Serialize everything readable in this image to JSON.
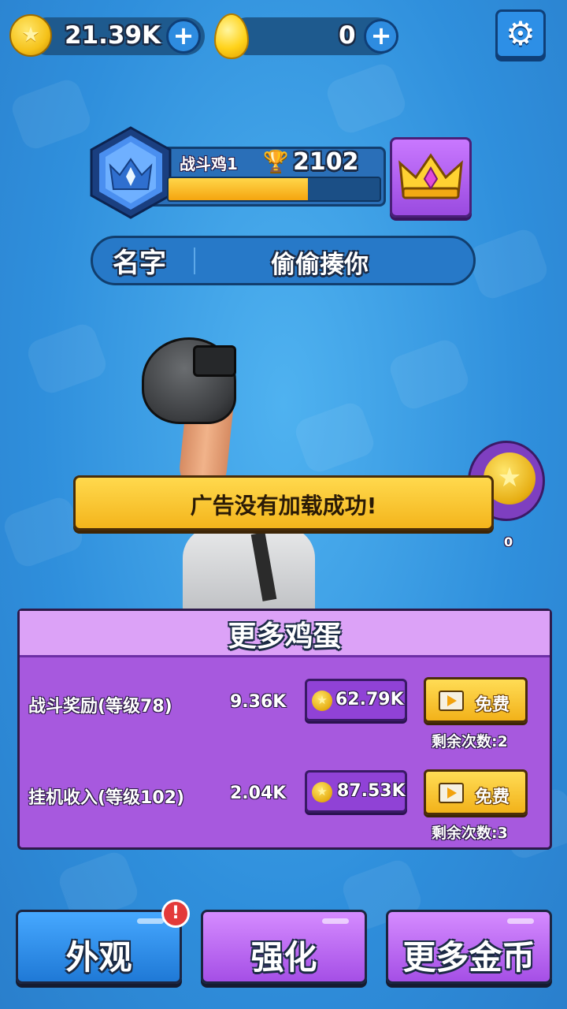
{
  "currency": {
    "coins": "21.39K",
    "eggs": "0"
  },
  "player": {
    "name": "战斗鸡1",
    "trophies": "2102",
    "xp_progress": 0.66
  },
  "profile": {
    "name_label": "名字",
    "name_value": "偷偷揍你"
  },
  "toast": {
    "message": "广告没有加载成功!"
  },
  "side_reward": {
    "count": "0"
  },
  "more_eggs": {
    "title": "更多鸡蛋",
    "rows": [
      {
        "label": "战斗奖励(等级78)",
        "rate": "9.36K",
        "cost": "62.79K",
        "free_label": "免费",
        "remaining": "剩余次数:2"
      },
      {
        "label": "挂机收入(等级102)",
        "rate": "2.04K",
        "cost": "87.53K",
        "free_label": "免费",
        "remaining": "剩余次数:3"
      }
    ]
  },
  "bottom_nav": {
    "appearance": "外观",
    "upgrade": "强化",
    "more_coins": "更多金币",
    "alert": "!"
  },
  "colors": {
    "background": "#3a9ae6",
    "panel_purple": "#a759de",
    "button_yellow": "#f4b51c",
    "button_blue": "#1f79d6"
  }
}
